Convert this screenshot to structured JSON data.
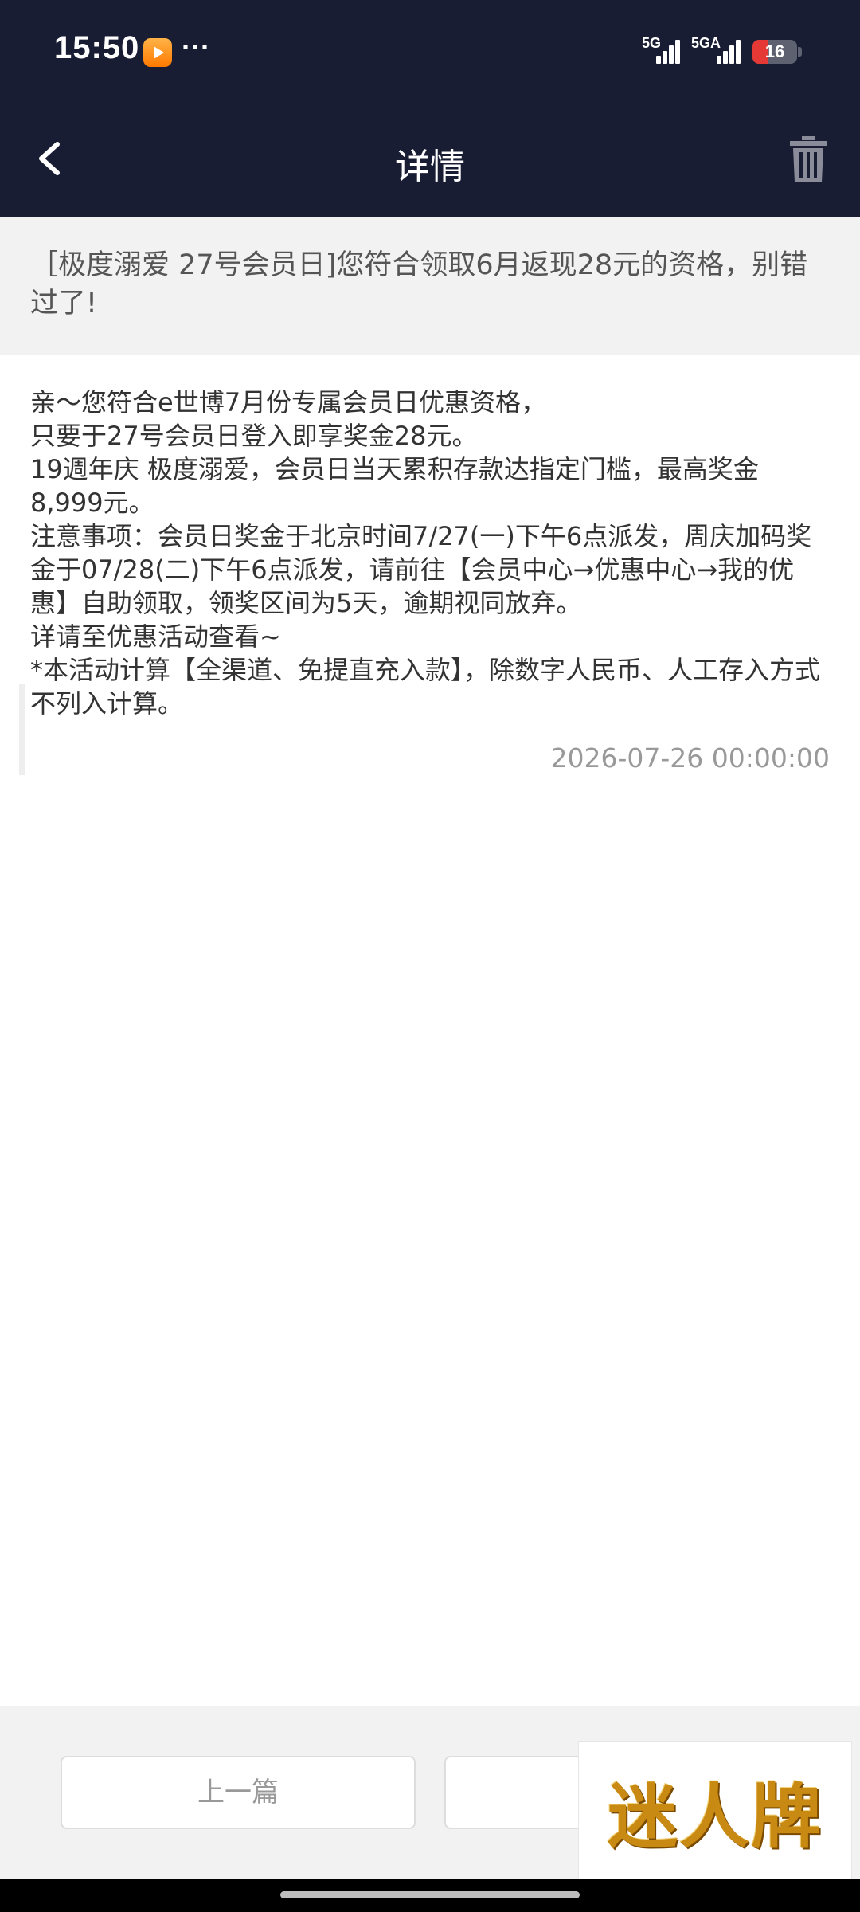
{
  "status_bar": {
    "time": "15:50",
    "more": "···",
    "network_1": "5G",
    "network_2": "5GA",
    "battery": "16",
    "battery_percent": 16,
    "app_icon": "video-app-icon"
  },
  "nav": {
    "title": "详情",
    "back_icon": "chevron-left-icon",
    "delete_icon": "trash-icon"
  },
  "message": {
    "subject": "［极度溺爱 27号会员日]您符合领取6月返现28元的资格，别错过了!",
    "lines": [
      "亲～您符合e世博7月份专属会员日优惠资格，",
      "只要于27号会员日登入即享奖金28元。",
      "19週年庆 极度溺爱，会员日当天累积存款达指定门槛，最高奖金8,999元。",
      "注意事项：会员日奖金于北京时间7/27(一)下午6点派发，周庆加码奖金于07/28(二)下午6点派发，请前往【会员中心→优惠中心→我的优惠】自助领取，领奖区间为5天，逾期视同放弃。",
      "详请至优惠活动查看~",
      "*本活动计算【全渠道、免提直充入款】，除数字人民币、人工存入方式不列入计算。"
    ],
    "date": "2026-07-26 00:00:00"
  },
  "footer": {
    "prev_label": "上一篇",
    "next_label": ""
  },
  "watermark": {
    "text": "迷人牌"
  },
  "colors": {
    "header_bg": "#181d33",
    "subject_bg": "#f2f2f2",
    "date_text": "#999999",
    "battery_low": "#e53935"
  }
}
